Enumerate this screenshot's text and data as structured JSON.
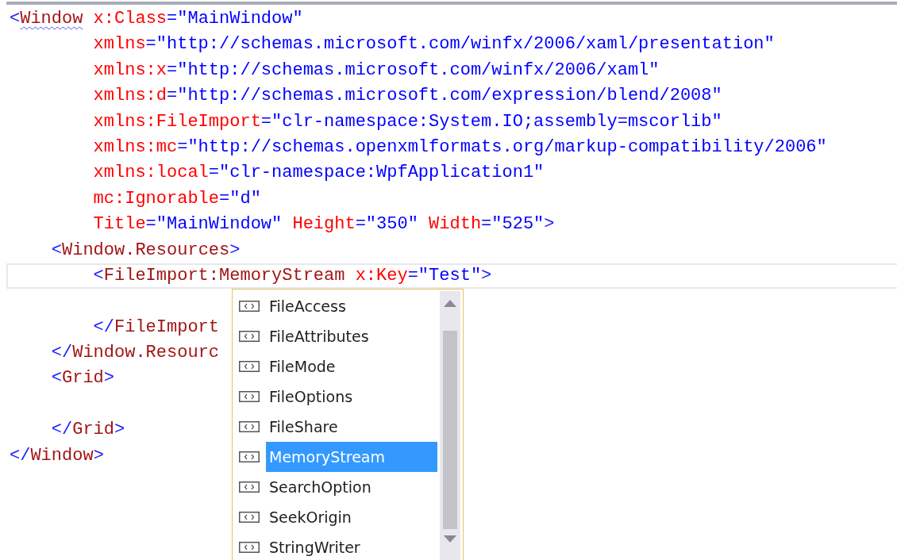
{
  "editor": {
    "lines": [
      {
        "kind": "root",
        "tokens": [
          {
            "kind": "bracket",
            "t": "<"
          },
          {
            "kind": "element",
            "t": "Window",
            "squiggle": true
          },
          {
            "kind": "attr",
            "t": " x:Class"
          },
          {
            "kind": "value",
            "t": "=\"MainWindow\""
          }
        ]
      },
      {
        "kind": "attribute",
        "tokens": [
          {
            "kind": "attr",
            "t": "xmlns"
          },
          {
            "kind": "value",
            "t": "=\"http://schemas.microsoft.com/winfx/2006/xaml/presentation\""
          }
        ]
      },
      {
        "kind": "attribute",
        "tokens": [
          {
            "kind": "attr",
            "t": "xmlns:x"
          },
          {
            "kind": "value",
            "t": "=\"http://schemas.microsoft.com/winfx/2006/xaml\""
          }
        ]
      },
      {
        "kind": "attribute",
        "tokens": [
          {
            "kind": "attr",
            "t": "xmlns:d"
          },
          {
            "kind": "value",
            "t": "=\"http://schemas.microsoft.com/expression/blend/2008\""
          }
        ]
      },
      {
        "kind": "attribute",
        "tokens": [
          {
            "kind": "attr",
            "t": "xmlns:FileImport"
          },
          {
            "kind": "value",
            "t": "=\"clr-namespace:System.IO;assembly=mscorlib\""
          }
        ]
      },
      {
        "kind": "attribute",
        "tokens": [
          {
            "kind": "attr",
            "t": "xmlns:mc"
          },
          {
            "kind": "value",
            "t": "=\"http://schemas.openxmlformats.org/markup-compatibility/2006\""
          }
        ]
      },
      {
        "kind": "attribute",
        "tokens": [
          {
            "kind": "attr",
            "t": "xmlns:local"
          },
          {
            "kind": "value",
            "t": "=\"clr-namespace:WpfApplication1\""
          }
        ]
      },
      {
        "kind": "attribute",
        "tokens": [
          {
            "kind": "attr",
            "t": "mc:Ignorable"
          },
          {
            "kind": "value",
            "t": "=\"d\""
          }
        ]
      },
      {
        "kind": "attribute",
        "tokens": [
          {
            "kind": "attr",
            "t": "Title"
          },
          {
            "kind": "value",
            "t": "=\"MainWindow\""
          },
          {
            "kind": "attr",
            "t": " Height"
          },
          {
            "kind": "value",
            "t": "=\"350\""
          },
          {
            "kind": "attr",
            "t": " Width"
          },
          {
            "kind": "value",
            "t": "=\"525\""
          },
          {
            "kind": "bracket",
            "t": ">"
          }
        ]
      },
      {
        "kind": "child",
        "tokens": [
          {
            "kind": "bracket",
            "t": "<"
          },
          {
            "kind": "element",
            "t": "Window.Resources"
          },
          {
            "kind": "bracket",
            "t": ">"
          }
        ]
      },
      {
        "kind": "grandchild",
        "current": true,
        "tokens": [
          {
            "kind": "bracket",
            "t": "<"
          },
          {
            "kind": "element",
            "t": "FileImport:MemoryStream"
          },
          {
            "kind": "attr",
            "t": " x:Key"
          },
          {
            "kind": "value",
            "t": "=\"Test\""
          },
          {
            "kind": "bracket",
            "t": ">"
          }
        ]
      },
      {
        "kind": "blank"
      },
      {
        "kind": "grandchild",
        "tokens": [
          {
            "kind": "bracket",
            "t": "</"
          },
          {
            "kind": "element",
            "t": "FileImport"
          }
        ]
      },
      {
        "kind": "child",
        "tokens": [
          {
            "kind": "bracket",
            "t": "</"
          },
          {
            "kind": "element",
            "t": "Window.Resourc"
          }
        ]
      },
      {
        "kind": "child",
        "tokens": [
          {
            "kind": "bracket",
            "t": "<"
          },
          {
            "kind": "element",
            "t": "Grid"
          },
          {
            "kind": "bracket",
            "t": ">"
          }
        ]
      },
      {
        "kind": "blank"
      },
      {
        "kind": "child",
        "tokens": [
          {
            "kind": "bracket",
            "t": "</"
          },
          {
            "kind": "element",
            "t": "Grid"
          },
          {
            "kind": "bracket",
            "t": ">"
          }
        ]
      },
      {
        "kind": "root",
        "tokens": [
          {
            "kind": "bracket",
            "t": "</"
          },
          {
            "kind": "element",
            "t": "Window"
          },
          {
            "kind": "bracket",
            "t": ">"
          }
        ]
      }
    ]
  },
  "completion": {
    "items": [
      {
        "label": "FileAccess",
        "selected": false
      },
      {
        "label": "FileAttributes",
        "selected": false
      },
      {
        "label": "FileMode",
        "selected": false
      },
      {
        "label": "FileOptions",
        "selected": false
      },
      {
        "label": "FileShare",
        "selected": false
      },
      {
        "label": "MemoryStream",
        "selected": true
      },
      {
        "label": "SearchOption",
        "selected": false
      },
      {
        "label": "SeekOrigin",
        "selected": false
      },
      {
        "label": "StringWriter",
        "selected": false
      }
    ]
  }
}
